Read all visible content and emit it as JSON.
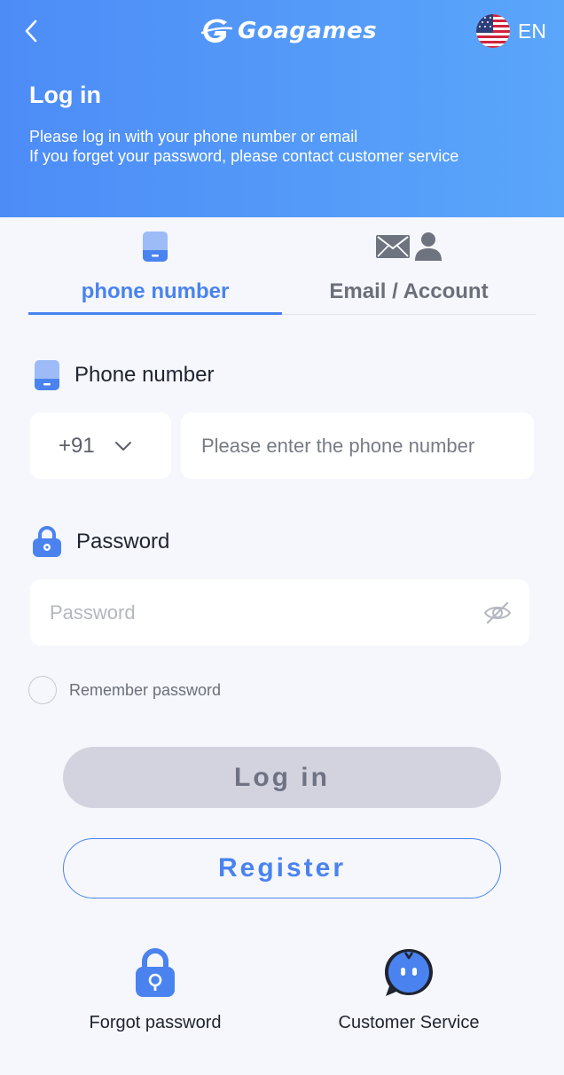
{
  "header": {
    "logo_text": "Goagames",
    "language": "EN",
    "title": "Log in",
    "subtitle_line1": "Please log in with your phone number or email",
    "subtitle_line2": "If you forget your password, please contact customer service"
  },
  "tabs": [
    {
      "label": "phone number",
      "icon": "phone-icon",
      "active": true
    },
    {
      "label": "Email / Account",
      "icon": "mail-user-icon",
      "active": false
    }
  ],
  "form": {
    "phone_label": "Phone number",
    "country_code": "+91",
    "phone_placeholder": "Please enter the phone number",
    "password_label": "Password",
    "password_placeholder": "Password",
    "remember_label": "Remember password"
  },
  "actions": {
    "login_label": "Log in",
    "register_label": "Register"
  },
  "footer": {
    "forgot_label": "Forgot password",
    "service_label": "Customer Service"
  },
  "colors": {
    "header_gradient_start": "#4d8cf7",
    "header_gradient_end": "#5aa6fa",
    "accent": "#4a83ef",
    "background": "#f6f7fc",
    "login_disabled": "#d2d3de"
  }
}
